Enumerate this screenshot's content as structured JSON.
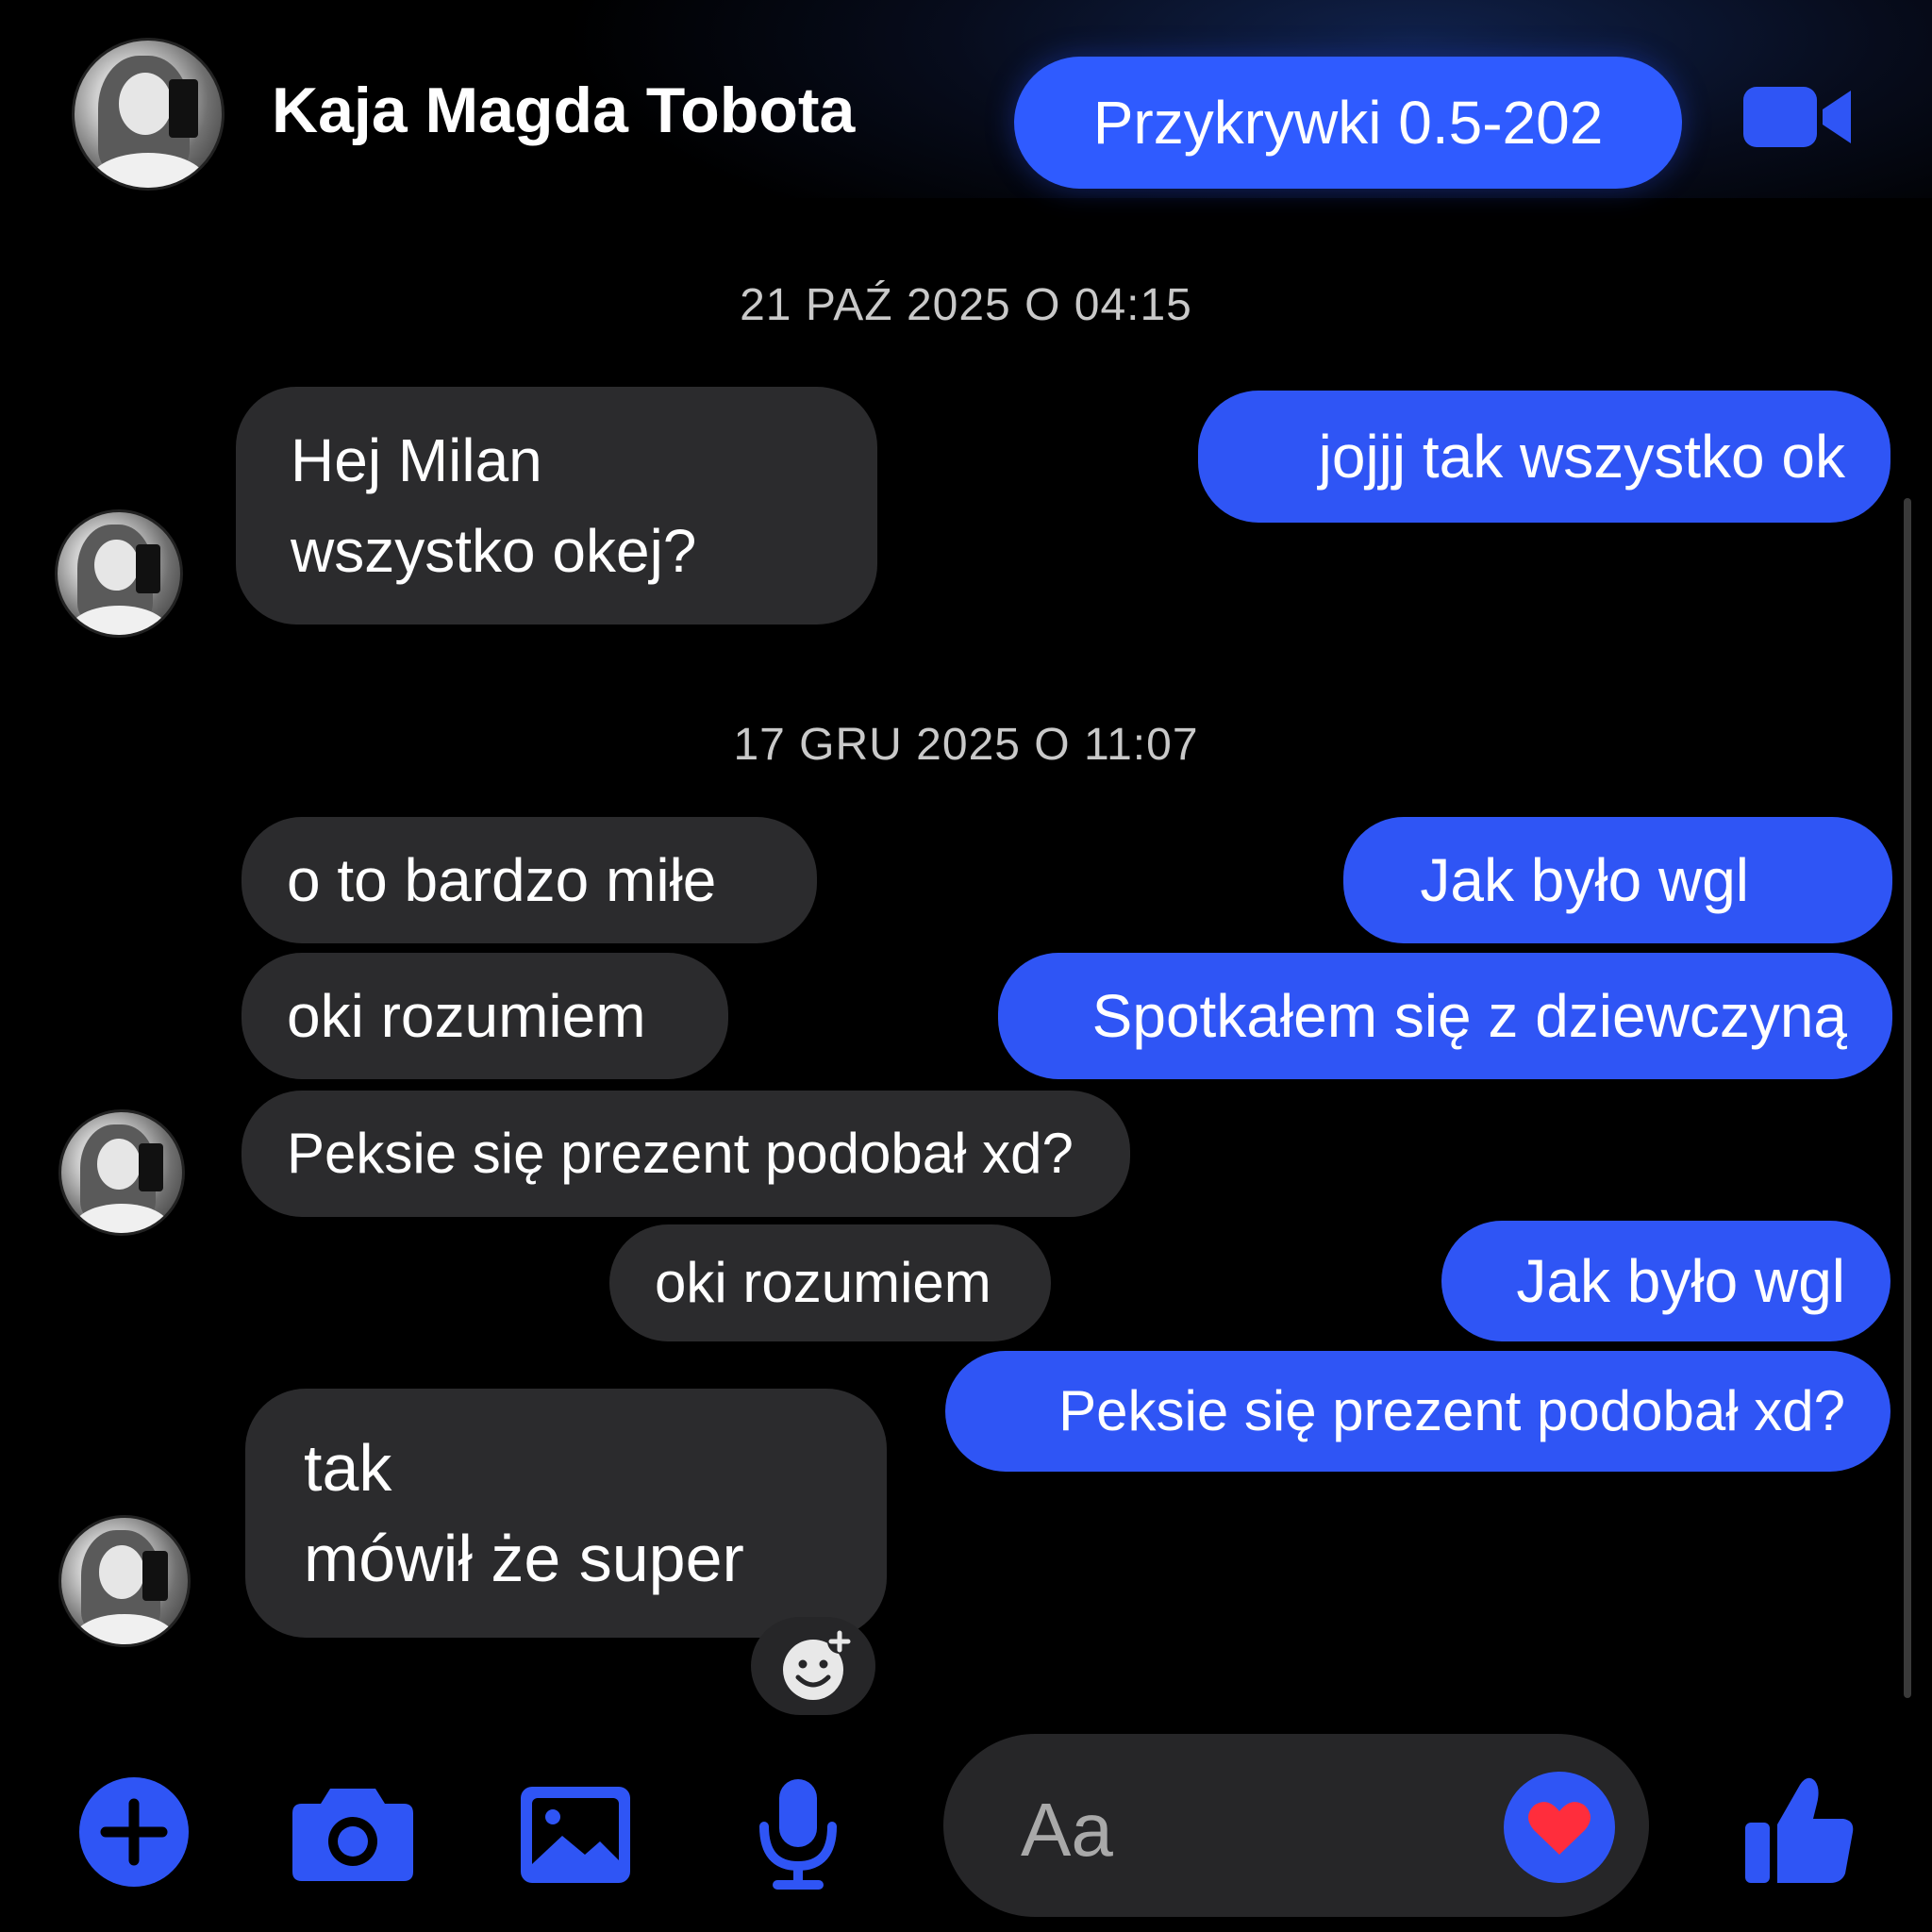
{
  "header": {
    "contact_name": "Kaja Magda Tobota",
    "pill_label": "Przykrywki 0.5-202",
    "video_icon": "video-camera-icon"
  },
  "conversation": {
    "timestamps": [
      "21 PAŹ 2025 O 04:15",
      "17 GRU 2025 O 11:07"
    ],
    "messages": [
      {
        "side": "in",
        "text": "Hej Milan\nwszystko okej?"
      },
      {
        "side": "out",
        "text": "jojjj tak wszystko ok"
      },
      {
        "side": "in",
        "text": "o to bardzo miłe"
      },
      {
        "side": "out",
        "text": "Jak było wgl"
      },
      {
        "side": "in",
        "text": "oki rozumiem"
      },
      {
        "side": "out",
        "text": "Spotkałem się z dziewczyną"
      },
      {
        "side": "in",
        "text": "Peksie się prezent podobał xd?"
      },
      {
        "side": "in",
        "text": "oki rozumiem"
      },
      {
        "side": "out",
        "text": "Jak było wgl"
      },
      {
        "side": "out",
        "text": "Peksie się prezent podobał xd?"
      },
      {
        "side": "in",
        "text": "tak\nmówił że super"
      }
    ],
    "reaction_icon": "add-reaction-smiley-icon"
  },
  "composer": {
    "placeholder": "Aa",
    "icons": [
      "plus-icon",
      "camera-icon",
      "gallery-icon",
      "microphone-icon",
      "heart-icon",
      "thumbs-up-icon"
    ]
  },
  "colors": {
    "accent": "#2f55f5",
    "incoming_bubble": "#2b2b2d",
    "background": "#000000"
  }
}
